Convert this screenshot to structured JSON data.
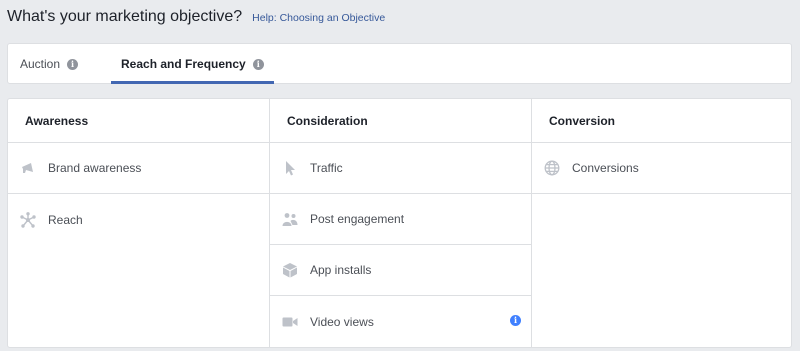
{
  "header": {
    "title": "What's your marketing objective?",
    "help_link": "Help: Choosing an Objective"
  },
  "tabs": [
    {
      "label": "Auction",
      "active": false
    },
    {
      "label": "Reach and Frequency",
      "active": true
    }
  ],
  "columns": [
    {
      "heading": "Awareness",
      "items": [
        {
          "label": "Brand awareness",
          "icon": "megaphone-icon"
        },
        {
          "label": "Reach",
          "icon": "reach-icon"
        }
      ]
    },
    {
      "heading": "Consideration",
      "items": [
        {
          "label": "Traffic",
          "icon": "cursor-icon"
        },
        {
          "label": "Post engagement",
          "icon": "people-icon"
        },
        {
          "label": "App installs",
          "icon": "box-icon"
        },
        {
          "label": "Video views",
          "icon": "video-camera-icon"
        }
      ]
    },
    {
      "heading": "Conversion",
      "items": [
        {
          "label": "Conversions",
          "icon": "globe-icon"
        }
      ]
    }
  ],
  "colors": {
    "accent": "#4267b2",
    "icon_gray": "#bec2c9",
    "info_blue": "#4080ff",
    "link": "#365899"
  }
}
